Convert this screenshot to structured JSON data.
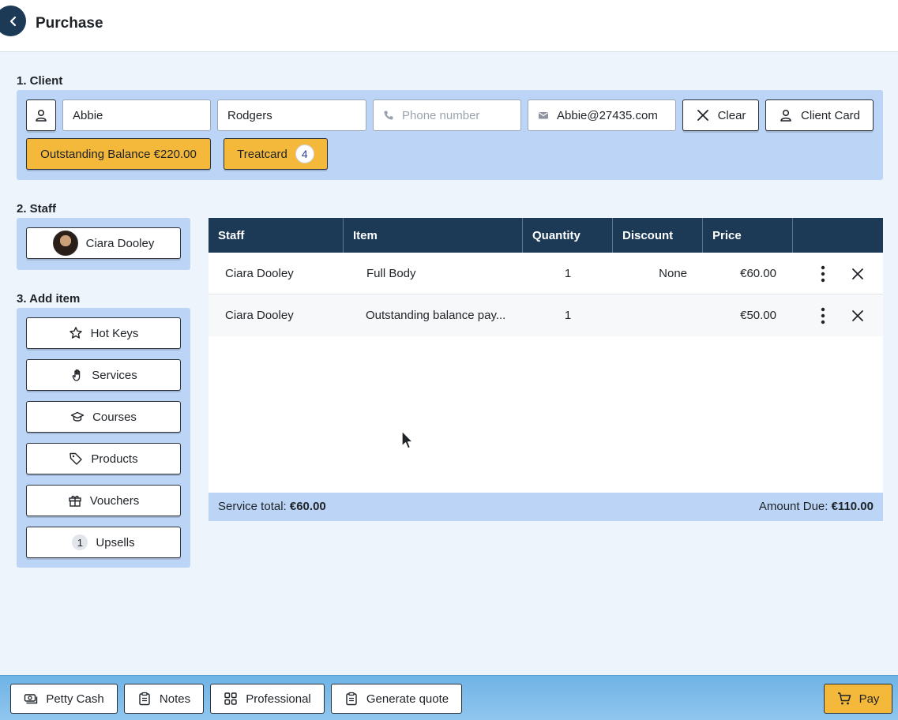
{
  "header": {
    "title": "Purchase"
  },
  "sections": {
    "client": "1. Client",
    "staff": "2. Staff",
    "add_item": "3. Add item"
  },
  "client": {
    "first_name": "Abbie",
    "last_name": "Rodgers",
    "phone_placeholder": "Phone number",
    "email": "Abbie@27435.com",
    "clear_label": "Clear",
    "client_card_label": "Client Card",
    "outstanding_label": "Outstanding Balance €220.00",
    "treatcard_label": "Treatcard",
    "treatcard_count": "4"
  },
  "staff": {
    "name": "Ciara Dooley"
  },
  "add_item": {
    "hot_keys": "Hot Keys",
    "services": "Services",
    "courses": "Courses",
    "products": "Products",
    "vouchers": "Vouchers",
    "upsells": "Upsells",
    "upsells_count": "1"
  },
  "table": {
    "headers": {
      "staff": "Staff",
      "item": "Item",
      "quantity": "Quantity",
      "discount": "Discount",
      "price": "Price"
    },
    "rows": [
      {
        "staff": "Ciara Dooley",
        "item": "Full Body",
        "quantity": "1",
        "discount": "None",
        "price": "€60.00"
      },
      {
        "staff": "Ciara Dooley",
        "item": "Outstanding balance pay...",
        "quantity": "1",
        "discount": "",
        "price": "€50.00"
      }
    ],
    "footer": {
      "service_total_label": "Service total: ",
      "service_total_value": "€60.00",
      "amount_due_label": "Amount Due: ",
      "amount_due_value": "€110.00"
    }
  },
  "bottom": {
    "petty_cash": "Petty Cash",
    "notes": "Notes",
    "professional": "Professional",
    "generate_quote": "Generate quote",
    "pay": "Pay"
  },
  "colors": {
    "navy": "#1c3a56",
    "panel": "#bcd5f6",
    "accent": "#f4b83b"
  }
}
